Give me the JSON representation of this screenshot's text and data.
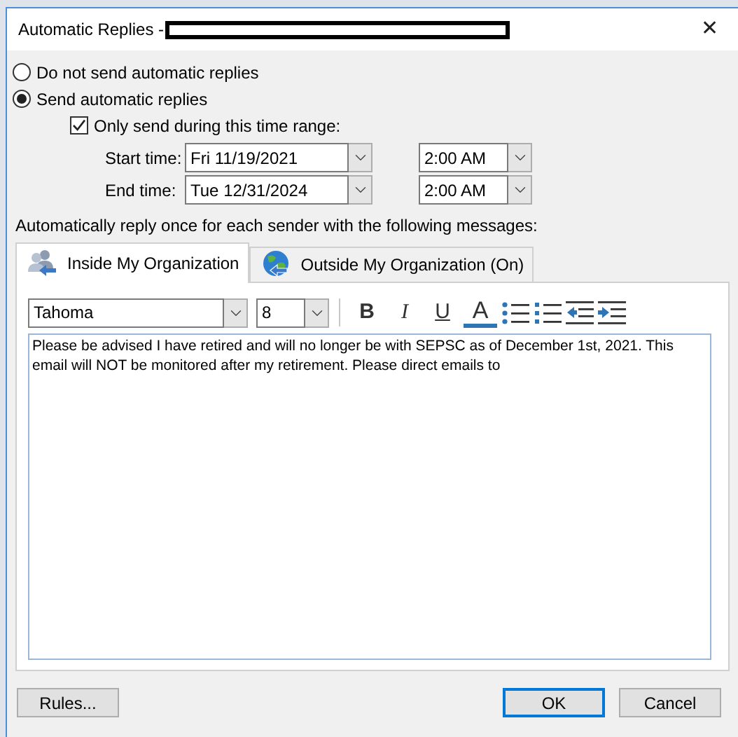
{
  "window": {
    "title": "Automatic Replies -",
    "close": "✕"
  },
  "reply_modes": [
    {
      "label": "Do not send automatic replies",
      "selected": false
    },
    {
      "label": "Send automatic replies",
      "selected": true
    }
  ],
  "time_range": {
    "label": "Only send during this time range:",
    "checked": true
  },
  "times": [
    {
      "label": "Start time:",
      "date": "Fri 11/19/2021",
      "time": "2:00 AM"
    },
    {
      "label": "End time:",
      "date": "Tue 12/31/2024",
      "time": "2:00 AM"
    }
  ],
  "message_label": "Automatically reply once for each sender with the following messages:",
  "tabs": [
    {
      "kind": "people",
      "label": "Inside My Organization",
      "selected": true
    },
    {
      "kind": "globe",
      "label": "Outside My Organization (On)",
      "selected": false
    }
  ],
  "format_toolbar": {
    "font": "Tahoma",
    "size": "8",
    "buttons": [
      {
        "kind": "bold",
        "label": "B"
      },
      {
        "kind": "italic",
        "label": "I"
      },
      {
        "kind": "underline",
        "label": "U"
      },
      {
        "kind": "font-color",
        "label": "A"
      },
      {
        "kind": "bullets"
      },
      {
        "kind": "numbering"
      },
      {
        "kind": "outdent"
      },
      {
        "kind": "indent"
      }
    ]
  },
  "message": "Please be advised I have retired and will no longer be with SEPSC as of December 1st, 2021. This email will NOT be monitored after my retirement. Please direct emails to",
  "buttons": [
    {
      "label": "Rules...",
      "default": false
    },
    {
      "label": "OK",
      "default": true
    },
    {
      "label": "Cancel",
      "default": false
    }
  ]
}
